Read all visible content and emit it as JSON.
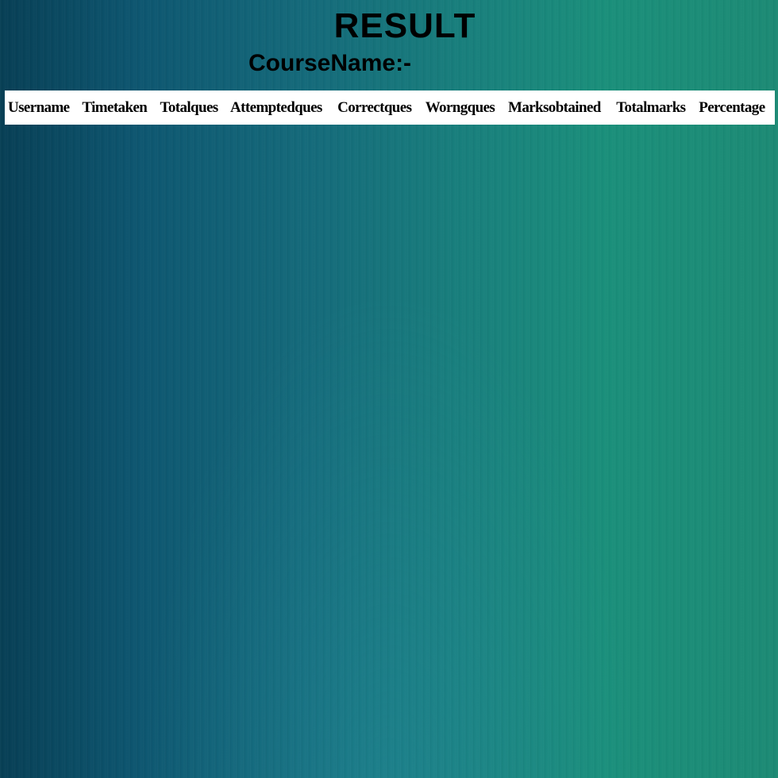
{
  "page": {
    "title": "RESULT",
    "course_label": "CourseName:-"
  },
  "table": {
    "columns": [
      "Username",
      "Timetaken",
      "Totalques",
      "Attemptedques",
      "Correctques",
      "Worngques",
      "Marksobtained",
      "Totalmarks",
      "Percentage"
    ],
    "rows": []
  },
  "colors": {
    "background_left": "#073f55",
    "background_right": "#1c8a74",
    "table_background": "#ffffff",
    "text": "#000000"
  }
}
